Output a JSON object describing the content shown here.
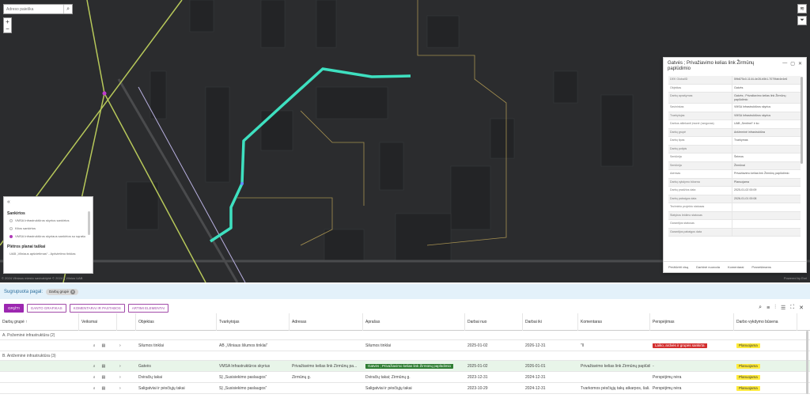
{
  "search": {
    "placeholder": "Adreso paieška"
  },
  "zoom": {
    "in": "+",
    "out": "−"
  },
  "map_tools": [
    "layers-icon",
    "filter-icon"
  ],
  "legend": {
    "collapse": "«",
    "section1": "Sankirtos",
    "items1": [
      {
        "label": "VMSA Infrastruktūros skyrius sankirtos",
        "active": false
      },
      {
        "label": "Kitos sankirtos",
        "active": false
      },
      {
        "label": "VMSA Infrastruktūros skyriaus sankirtos su sąrašu",
        "active": true
      }
    ],
    "section2": "Plėtros planai taškai",
    "items2": [
      {
        "label": "UAB „Vilniaus apšvietimas“ - Apšvietimo tinklas",
        "active": false
      }
    ]
  },
  "copyright": "© 2024 Vilniaus miesto savivaldybė © 2024 IĮ Vilnius UAB",
  "powered": "Powered by Esri",
  "popup": {
    "title": "Gatvės ; Privažiavimo kelias link Žirmūnų paplūdimio",
    "rows": [
      {
        "k": "DEK GlobalID",
        "v": "59b875c0-1144-4e28-b5b1-7079fab4e4e6"
      },
      {
        "k": "Objektas",
        "v": "Gatvės"
      },
      {
        "k": "Darbų aprašymas",
        "v": "Gatvės ; Privažiavimo kelias link Žirmūnų paplūdimio"
      },
      {
        "k": "Savininkas",
        "v": "VMSA Infrastruktūros skyrius"
      },
      {
        "k": "Tvarkytojas",
        "v": "VMSA Infrastruktūros skyrius"
      },
      {
        "k": "Darbus atliekanti įmonė (rangovas)",
        "v": "UAB „Sentinel“ ir ko"
      },
      {
        "k": "Darbų grupė",
        "v": "Antžeminė infrastruktūra"
      },
      {
        "k": "Darbų tipas",
        "v": "Tvarkymas"
      },
      {
        "k": "Darbų potipis",
        "v": ""
      },
      {
        "k": "Seniūnija",
        "v": "Šeimos"
      },
      {
        "k": "Seniūnija",
        "v": "Žirmūnai"
      },
      {
        "k": "Adresas",
        "v": "Privažiavimo kelias link Žirmūnų paplūdimio"
      },
      {
        "k": "Darbų vykdymo būsena",
        "v": "Planuojama"
      },
      {
        "k": "Darbų pradžios data",
        "v": "2025-01-02 00:09"
      },
      {
        "k": "Darbų pabaigos data",
        "v": "2026-01-01 00:08"
      },
      {
        "k": "Techninio projekto statusas",
        "v": ""
      },
      {
        "k": "Statybos leidimo statusas",
        "v": ""
      },
      {
        "k": "Garantijos statusas",
        "v": ""
      },
      {
        "k": "Garantijos pabaigos data",
        "v": ""
      }
    ],
    "footer": [
      "Peržiūrėti visą",
      "Darbinė nuoroda",
      "Komentarai",
      "Pranešimams"
    ]
  },
  "groupbar": {
    "label": "Sugrupuota pagal:",
    "chip": "Darbų grupė"
  },
  "toolbar": {
    "buttons": [
      "GRĮŽTI",
      "GANTO GRAFIKAS",
      "KOMENTARAI IR PASTABOS",
      "ARTIMI ELEMENTAI"
    ]
  },
  "grid": {
    "headers": [
      "Darbų grupė ↑",
      "Veiksmai",
      "",
      "Objektas",
      "Tvarkytojas",
      "Adresas",
      "Aprašas",
      "Darbai nuo",
      "Darbai iki",
      "Komentaras",
      "Perspėjimas",
      "Darbo vykdymo būsena"
    ],
    "groups": [
      {
        "label": "A. Požeminė infrastruktūra (2)",
        "rows": [
          {
            "objektas": "Šilumos tinklai",
            "tvarkytojas": "AB „Vilniaus šilumos tinklai“",
            "adresas": "",
            "aprasas": "Šilumos tinklai",
            "nuo": "2025-01-02",
            "iki": "2026-12-31",
            "komentaras": "\"ll",
            "perspejimas": "Laiko, ardvės ir grupės sankirta",
            "persp_type": "red",
            "busena": "Planuojama",
            "sel": false
          }
        ]
      },
      {
        "label": "B. Antžeminė infrastruktūra (3)",
        "rows": [
          {
            "objektas": "Gatvės",
            "tvarkytojas": "VMSA Infrastruktūros skyrius",
            "adresas": "Privažiavimo kelias link Žirmūnų pa...",
            "aprasas": "Gatvės ; Privažiavimo kelias link Žirmūnų paplūdimio",
            "apr_badge": true,
            "nuo": "2025-01-02",
            "iki": "2026-01-01",
            "komentaras": "Privažiavimo kelias link Žirmūnų paplūdi...",
            "perspejimas": "-",
            "persp_type": "none",
            "busena": "Planuojama",
            "sel": true
          },
          {
            "objektas": "Dviračių takai",
            "tvarkytojas": "SĮ „Susisiekimo paslaugos“",
            "adresas": "Žirmūnų g.",
            "aprasas": "Dviračių takai; Žirmūnų g.",
            "nuo": "2023-12-31",
            "iki": "2024-12-31",
            "komentaras": "",
            "perspejimas": "Perspėjimų nėra",
            "persp_type": "none",
            "busena": "Planuojama",
            "sel": false
          },
          {
            "objektas": "Šaligatviai ir pėsčiųjų takai",
            "tvarkytojas": "SĮ „Susisiekimo paslaugos“",
            "adresas": "",
            "aprasas": "Šaligatviai ir pėsčiųjų takai",
            "nuo": "2023-10-29",
            "iki": "2024-12-31",
            "komentaras": "Tvarkomos pėsčiųjų takų atkarpos, šali...",
            "perspejimas": "Perspėjimų nėra",
            "persp_type": "none",
            "busena": "Planuojama",
            "sel": false
          }
        ]
      }
    ]
  },
  "colors": {
    "route": "#3ee0c0",
    "accent": "#9c27b0",
    "map_bg": "#2b2c2e"
  }
}
